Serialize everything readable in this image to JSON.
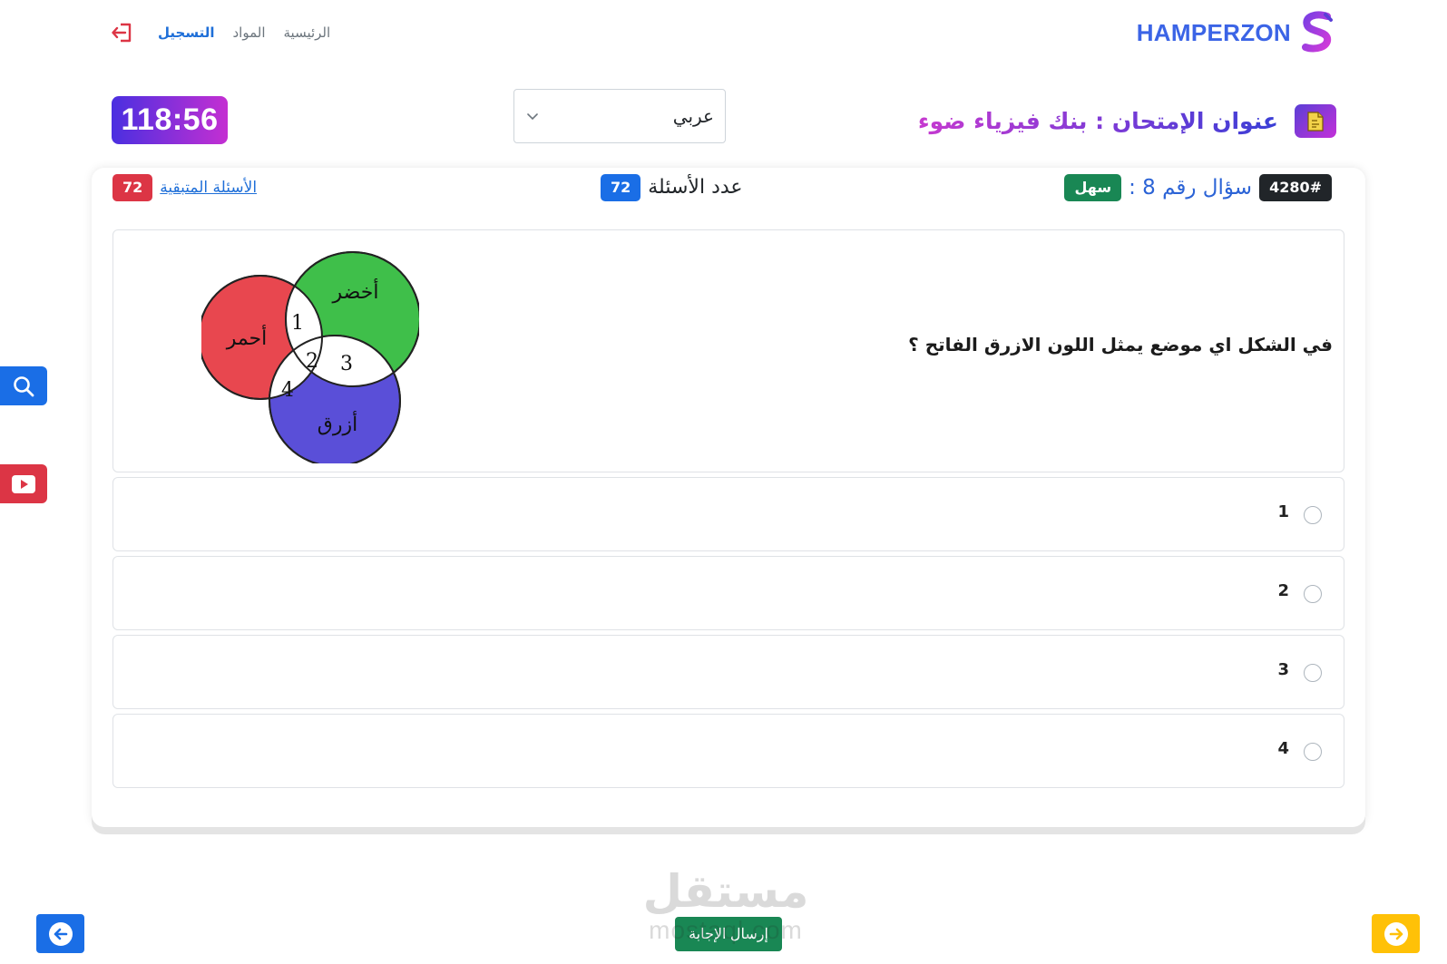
{
  "brand": {
    "name": "HAMPERZON",
    "logo_icon": "s-logo-icon"
  },
  "nav": {
    "home": "الرئيسية",
    "subjects": "المواد",
    "register": "التسجيل",
    "logout_icon": "logout-icon"
  },
  "exam": {
    "title": "عنوان الإمتحان : بنك فيزياء ضوء",
    "icon": "document-icon",
    "language": "عربي",
    "timer": "118:56"
  },
  "question_meta": {
    "id": "4280#",
    "number_label": "سؤال رقم 8 :",
    "difficulty": "سهل",
    "count_label": "عدد الأسئلة",
    "count": "72",
    "remaining_label": "الأسئلة المتبقية",
    "remaining": "72"
  },
  "question": {
    "text": "في الشكل اي موضع يمثل اللون الازرق الفاتح ؟",
    "venn": {
      "red_label": "أحمر",
      "green_label": "أخضر",
      "blue_label": "أزرق",
      "region_1": "1",
      "region_2": "2",
      "region_3": "3",
      "region_4": "4"
    }
  },
  "options": [
    "1",
    "2",
    "3",
    "4"
  ],
  "footer": {
    "submit": "إرسال الإجابة",
    "prev_icon": "arrow-left-icon",
    "next_icon": "arrow-right-icon"
  },
  "side": {
    "search_icon": "search-icon",
    "video_icon": "youtube-icon"
  },
  "watermark": {
    "arabic": "مستقل",
    "latin": "mostaql.com"
  },
  "colors": {
    "primary": "#1a6ee6",
    "danger": "#dc3545",
    "success": "#198754",
    "warning": "#ffc107",
    "timer_gradient_start": "#4a2fe0",
    "timer_gradient_end": "#c42fd2",
    "venn_red": "#e8474f",
    "venn_green": "#3fbf4a",
    "venn_blue": "#5a4fd8"
  }
}
